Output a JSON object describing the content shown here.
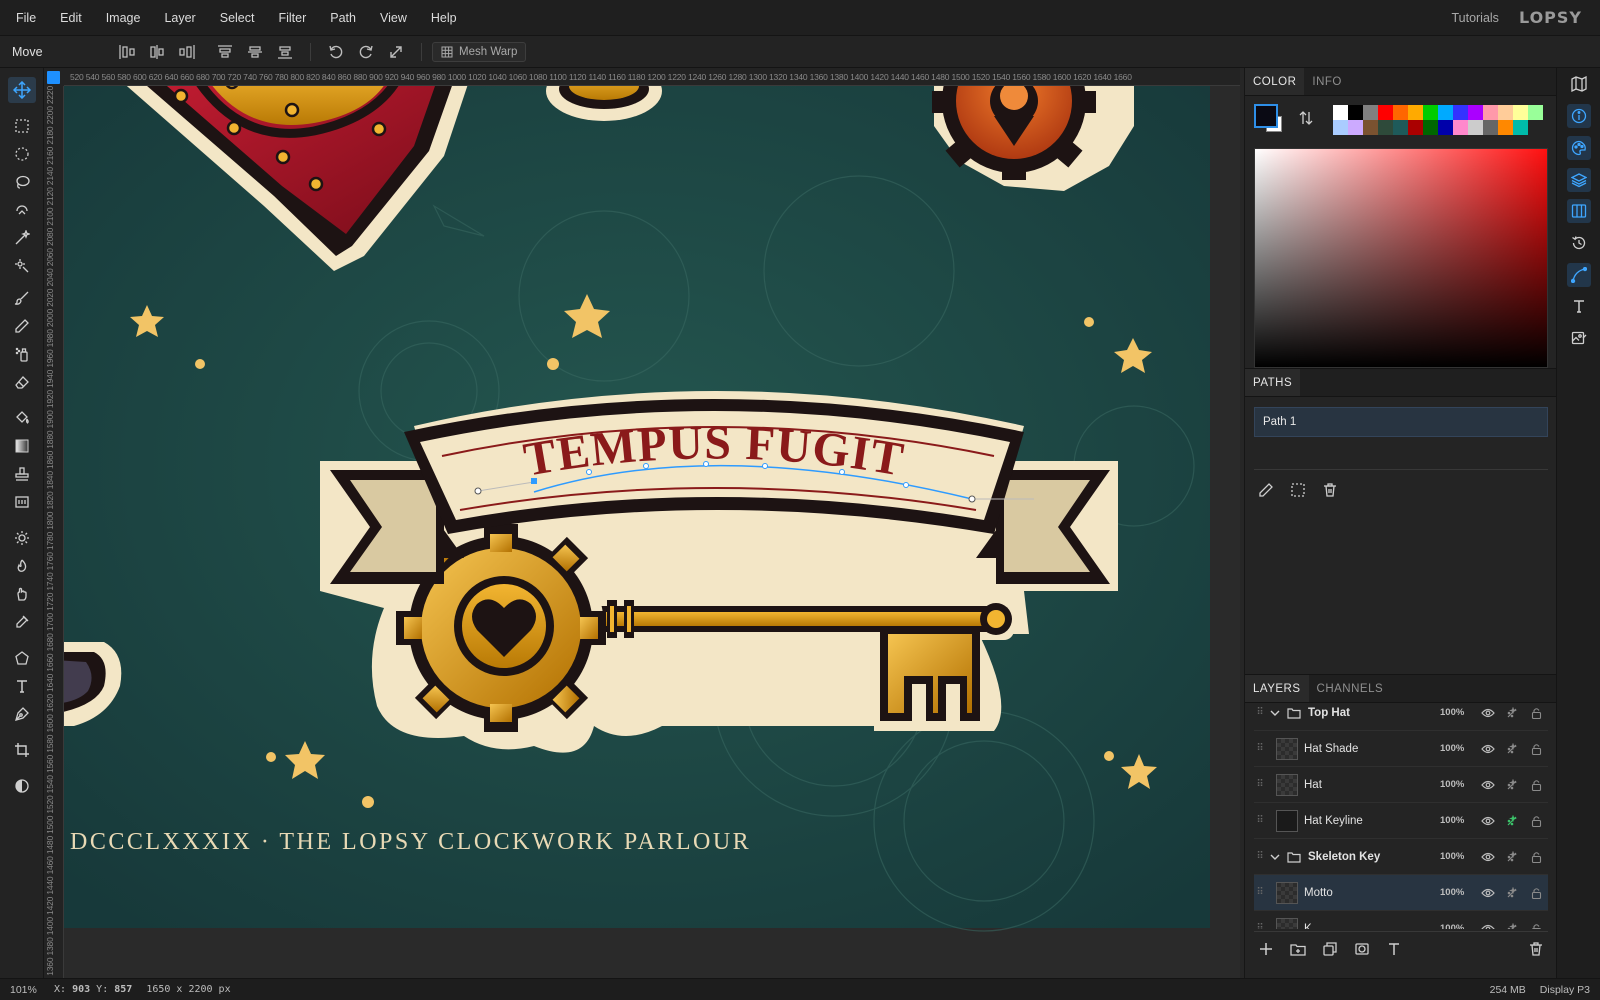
{
  "menubar": {
    "items": [
      "File",
      "Edit",
      "Image",
      "Layer",
      "Select",
      "Filter",
      "Path",
      "View",
      "Help"
    ],
    "tutorials": "Tutorials",
    "logo": "LOPSY"
  },
  "options_bar": {
    "tool_name": "Move",
    "mesh_warp_label": "Mesh Warp",
    "buttons": [
      "align-left-icon",
      "align-center-h-icon",
      "align-right-icon",
      "align-top-icon",
      "align-middle-v-icon",
      "align-bottom-icon",
      "rotate-ccw-icon",
      "rotate-cw-icon",
      "expand-icon"
    ]
  },
  "toolbar": {
    "tools": [
      "move-tool-icon",
      "rect-select-icon",
      "ellipse-select-icon",
      "lasso-icon",
      "magnetic-lasso-icon",
      "magic-wand-icon",
      "quick-select-icon",
      "brush-icon",
      "pencil-icon",
      "spray-icon",
      "eraser-icon",
      "bucket-icon",
      "gradient-icon",
      "stamp-icon",
      "pattern-icon",
      "dodge-icon",
      "burn-icon",
      "smudge-icon",
      "eyedropper-icon",
      "shape-icon",
      "text-icon",
      "pen-icon",
      "crop-icon",
      "contrast-icon"
    ],
    "active": "move-tool-icon"
  },
  "rulers": {
    "horizontal": "520 540 560 580 600 620 640 660 680 700 720 740 760 780 800 820 840 860 880 900 920 940 960 980 1000 1020 1040 1060 1080 1100 1120 1140 1160 1180 1200 1220 1240 1260 1280 1300 1320 1340 1360 1380 1400 1420 1440 1460 1480 1500 1520 1540 1560 1580 1600 1620 1640 1660",
    "vertical": "1300 1320 1340 1360 1380 1400 1420 1440 1460 1480 1500 1520 1540 1560 1580 1600 1620 1640 1660 1680 1700 1720 1740 1760 1780 1800 1820 1840 1860 1880 1900 1920 1940 1960 1980 2000 2020 2040 2060 2080 2100 2120 2140 2160 2180 2200 2220"
  },
  "canvas": {
    "banner_text": "TEMPUS FUGIT",
    "footer_text": "DCCCLXXXIX · THE LOPSY CLOCKWORK PARLOUR",
    "bg_color": "#1e4a44",
    "accent_gold": "#d69a12",
    "banner_red": "#8a1a1a"
  },
  "color_panel": {
    "tabs": [
      "COLOR",
      "INFO"
    ],
    "active_tab": "COLOR",
    "foreground": "#0a0a14",
    "background": "#ffffff",
    "swatches": [
      "#ffffff",
      "#000000",
      "#808080",
      "#ff0000",
      "#ff6600",
      "#ffaa00",
      "#00cc00",
      "#00aaff",
      "#3333ff",
      "#aa00ff",
      "#ff99aa",
      "#ffcc99",
      "#ffff99",
      "#99ff99",
      "#aaccff",
      "#ccaaff",
      "#7a5230",
      "#2e4a3a",
      "#1e5a5a",
      "#aa0000",
      "#006600",
      "#0000aa",
      "#ff88cc",
      "#cccccc",
      "#666666",
      "#ff8800",
      "#00bbaa"
    ]
  },
  "paths_panel": {
    "title": "PATHS",
    "paths": [
      "Path 1"
    ],
    "tools": [
      "edit-path-icon",
      "path-to-selection-icon",
      "delete-path-icon"
    ]
  },
  "layers_panel": {
    "tabs": [
      "LAYERS",
      "CHANNELS"
    ],
    "active_tab": "LAYERS",
    "layers": [
      {
        "name": "Top Hat",
        "opacity": "100%",
        "type": "group"
      },
      {
        "name": "Hat Shade",
        "opacity": "100%",
        "type": "layer"
      },
      {
        "name": "Hat",
        "opacity": "100%",
        "type": "layer"
      },
      {
        "name": "Hat Keyline",
        "opacity": "100%",
        "type": "layer"
      },
      {
        "name": "Skeleton Key",
        "opacity": "100%",
        "type": "group"
      },
      {
        "name": "Motto",
        "opacity": "100%",
        "type": "layer",
        "selected": true
      },
      {
        "name": "K...",
        "opacity": "100%",
        "type": "layer"
      }
    ],
    "footer_tools": [
      "add-layer-icon",
      "add-group-icon",
      "duplicate-icon",
      "mask-icon",
      "text-layer-icon",
      "delete-layer-icon"
    ]
  },
  "right_strip": {
    "icons": [
      "map-icon",
      "info-icon",
      "palette-icon",
      "layers-icon",
      "columns-icon",
      "history-icon",
      "path-icon",
      "text-icon",
      "image-edit-icon"
    ],
    "active": [
      "info-icon",
      "palette-icon",
      "layers-icon",
      "columns-icon",
      "path-icon"
    ]
  },
  "status": {
    "zoom": "101%",
    "x_label": "X:",
    "x": "903",
    "y_label": "Y:",
    "y": "857",
    "dimensions": "1650 x 2200 px",
    "memory": "254 MB",
    "profile": "Display P3"
  }
}
